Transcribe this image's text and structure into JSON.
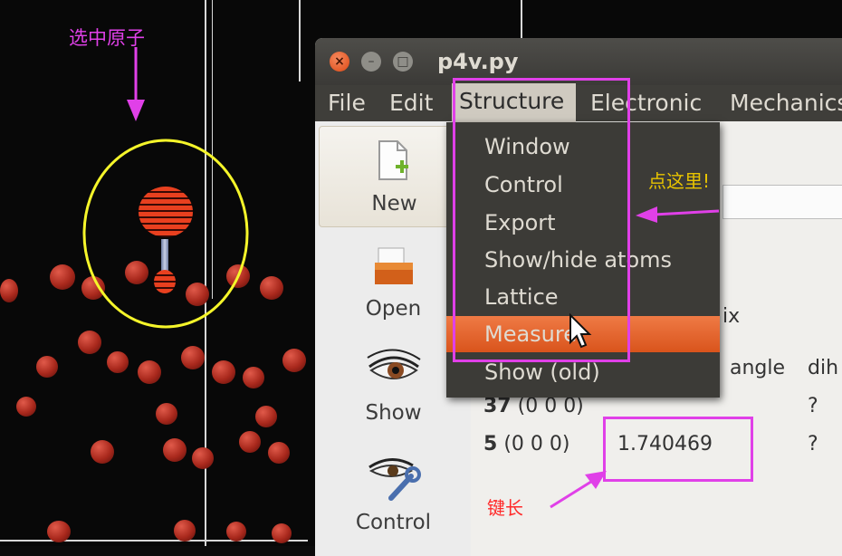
{
  "app": {
    "title": "p4v.py"
  },
  "menu": {
    "items": [
      "File",
      "Edit",
      "Structure",
      "Electronic",
      "Mechanics"
    ]
  },
  "structure_menu": {
    "items": [
      "Window",
      "Control",
      "Export",
      "Show/hide atoms",
      "Lattice",
      "Measure",
      "Show (old)"
    ],
    "highlighted": "Measure"
  },
  "toolbar": {
    "buttons": [
      "New",
      "Open",
      "Show",
      "Control"
    ]
  },
  "measure_panel": {
    "ix_fragment": "ix",
    "headers": {
      "angle": "angle",
      "dih": "dih"
    },
    "rows": [
      {
        "atom": "37",
        "cell": "(0 0 0)",
        "value": "",
        "dih": "?"
      },
      {
        "atom": "5",
        "cell": "(0 0 0)",
        "value": "1.740469",
        "dih": "?"
      }
    ]
  },
  "annotations": {
    "select_atom": "选中原子",
    "click_here": "点这里!",
    "bond_length": "键长",
    "colors": {
      "magenta": "#e040e8",
      "yellow": "#f5f52a",
      "label_orange": "#e8c400",
      "label_red": "#ff2a2a"
    }
  }
}
